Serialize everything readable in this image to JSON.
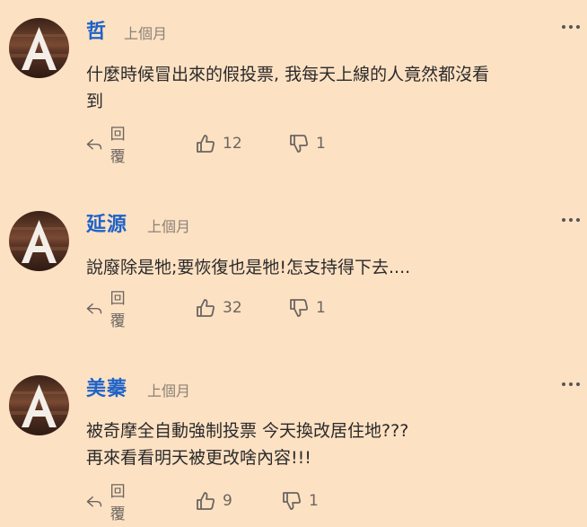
{
  "comments": [
    {
      "author": "哲",
      "time": "上個月",
      "text": "什麼時候冒出來的假投票, 我每天上線的人竟然都沒看\n到",
      "reply_label": "回覆",
      "likes": "12",
      "dislikes": "1"
    },
    {
      "author": "延源",
      "time": "上個月",
      "text": "說廢除是牠;要恢復也是牠!怎支持得下去....",
      "reply_label": "回覆",
      "likes": "32",
      "dislikes": "1"
    },
    {
      "author": "美蓁",
      "time": "上個月",
      "text": "被奇摩全自動強制投票 今天換改居住地???\n再來看看明天被更改啥內容!!!",
      "reply_label": "回覆",
      "likes": "9",
      "dislikes": "1"
    }
  ],
  "icons": {
    "avatar": "letter-a-avatar-icon",
    "more": "more-options-icon",
    "reply": "reply-arrow-icon",
    "like": "thumbs-up-icon",
    "dislike": "thumbs-down-icon"
  },
  "colors": {
    "background": "#fde1c3",
    "author": "#1e63c8",
    "meta": "#8a8178"
  }
}
